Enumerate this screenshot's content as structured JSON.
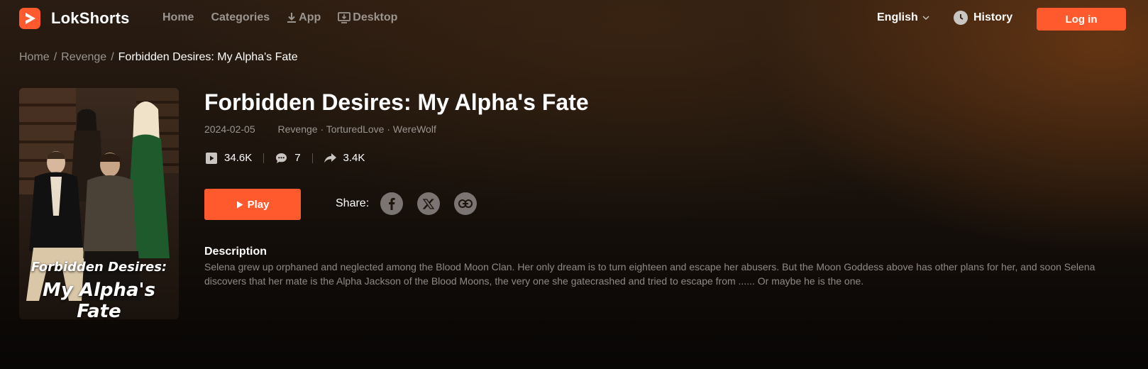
{
  "header": {
    "brand": "LokShorts",
    "nav": [
      {
        "label": "Home"
      },
      {
        "label": "Categories"
      },
      {
        "label": "App",
        "icon": "download-icon"
      },
      {
        "label": "Desktop",
        "icon": "desktop-download-icon"
      }
    ],
    "language": "English",
    "history_label": "History",
    "login_label": "Log in",
    "accent_color": "#ff5a2e"
  },
  "breadcrumb": {
    "items": [
      "Home",
      "Revenge"
    ],
    "separator": "/",
    "current": "Forbidden Desires: My Alpha's Fate"
  },
  "show": {
    "poster": {
      "title_line1": "Forbidden Desires:",
      "title_line2": "My Alpha's Fate"
    },
    "title": "Forbidden Desires: My Alpha's Fate",
    "date": "2024-02-05",
    "tags": "Revenge · TorturedLove · WereWolf",
    "stats": {
      "plays": "34.6K",
      "comments": "7",
      "shares": "3.4K"
    },
    "play_label": "Play",
    "share_label": "Share:",
    "share_icons": [
      "facebook-icon",
      "x-icon",
      "link-icon"
    ],
    "description_heading": "Description",
    "description": "Selena grew up orphaned and neglected among the Blood Moon Clan. Her only dream is to turn eighteen and escape her abusers. But the Moon Goddess above has other plans for her, and soon Selena discovers that her mate is the Alpha Jackson of the Blood Moons, the very one she gatecrashed and tried to escape from ...... Or maybe he is the one."
  }
}
